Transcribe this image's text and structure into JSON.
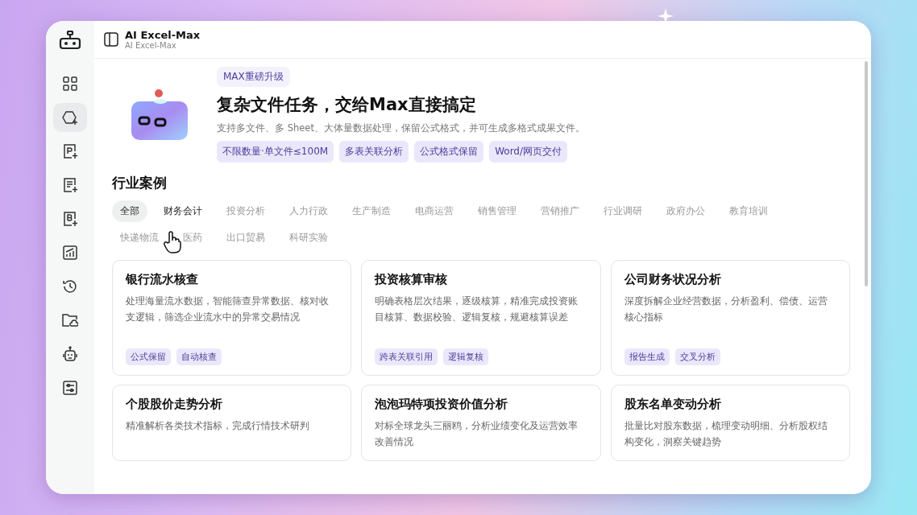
{
  "app": {
    "title": "AI Excel-Max",
    "subtitle": "AI Excel-Max"
  },
  "sidebar": {
    "items": [
      {
        "kind": "grid",
        "selected": false
      },
      {
        "kind": "max",
        "selected": true
      },
      {
        "kind": "p",
        "selected": false
      },
      {
        "kind": "doc",
        "selected": false
      },
      {
        "kind": "b",
        "selected": false
      },
      {
        "kind": "chart",
        "selected": false
      },
      {
        "kind": "history",
        "selected": false
      },
      {
        "kind": "folder",
        "selected": false
      },
      {
        "kind": "robot",
        "selected": false
      },
      {
        "kind": "settings",
        "selected": false
      }
    ]
  },
  "hero": {
    "badge": "MAX重磅升级",
    "title": "复杂文件任务，交给Max直接搞定",
    "description": "支持多文件、多 Sheet、大体量数据处理，保留公式格式，并可生成多格式成果文件。",
    "tags": [
      "不限数量·单文件≤100M",
      "多表关联分析",
      "公式格式保留",
      "Word/网页交付"
    ]
  },
  "cases": {
    "heading": "行业案例",
    "filters": [
      {
        "label": "全部",
        "selected": true,
        "hovered": false
      },
      {
        "label": "财务会计",
        "selected": false,
        "hovered": true
      },
      {
        "label": "投资分析",
        "selected": false,
        "hovered": false
      },
      {
        "label": "人力行政",
        "selected": false,
        "hovered": false
      },
      {
        "label": "生产制造",
        "selected": false,
        "hovered": false
      },
      {
        "label": "电商运营",
        "selected": false,
        "hovered": false
      },
      {
        "label": "销售管理",
        "selected": false,
        "hovered": false
      },
      {
        "label": "营销推广",
        "selected": false,
        "hovered": false
      },
      {
        "label": "行业调研",
        "selected": false,
        "hovered": false
      },
      {
        "label": "政府办公",
        "selected": false,
        "hovered": false
      },
      {
        "label": "教育培训",
        "selected": false,
        "hovered": false
      },
      {
        "label": "快递物流",
        "selected": false,
        "hovered": false
      },
      {
        "label": "医药",
        "selected": false,
        "hovered": false
      },
      {
        "label": "出口贸易",
        "selected": false,
        "hovered": false
      },
      {
        "label": "科研实验",
        "selected": false,
        "hovered": false
      }
    ],
    "cards": [
      {
        "title": "银行流水核查",
        "description": "处理海量流水数据，智能筛查异常数据、核对收支逻辑，筛选企业流水中的异常交易情况",
        "tags": [
          "公式保留",
          "自动核查"
        ]
      },
      {
        "title": "投资核算审核",
        "description": "明确表格层次结果，逐级核算，精准完成投资账目核算、数据校验、逻辑复核，规避核算误差",
        "tags": [
          "跨表关联引用",
          "逻辑复核"
        ]
      },
      {
        "title": "公司财务状况分析",
        "description": "深度拆解企业经营数据，分析盈利、偿债、运营核心指标",
        "tags": [
          "报告生成",
          "交叉分析"
        ]
      },
      {
        "title": "个股股价走势分析",
        "description": "精准解析各类技术指标，完成行情技术研判"
      },
      {
        "title": "泡泡玛特项投资价值分析",
        "description": "对标全球龙头三丽鸥，分析业绩变化及运营效率改善情况"
      },
      {
        "title": "股东名单变动分析",
        "description": "批量比对股东数据，梳理变动明细、分析股权结构变化，洞察关键趋势"
      }
    ]
  }
}
